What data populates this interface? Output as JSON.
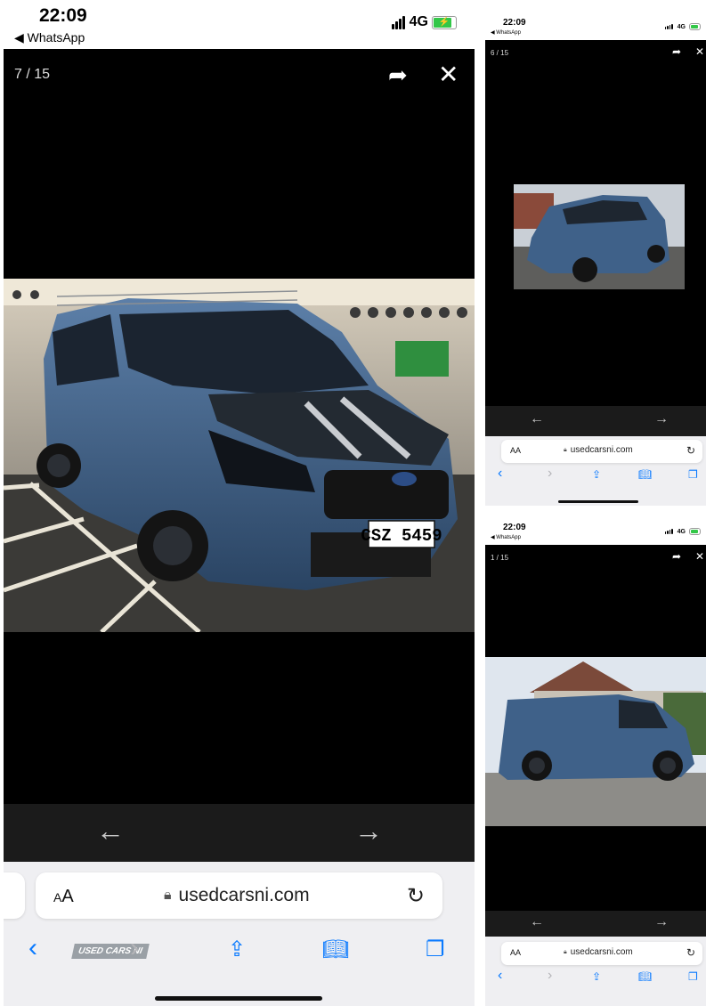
{
  "status": {
    "time": "22:09",
    "back_app": "WhatsApp",
    "network": "4G"
  },
  "main": {
    "counter": "7 / 15",
    "plate": "CSZ 5459",
    "url_domain": "usedcarsni.com",
    "aa_label": "AA",
    "watermark": "USED CARS NI"
  },
  "thumb_top": {
    "counter": "6 / 15",
    "url_domain": "usedcarsni.com",
    "aa_label": "AA"
  },
  "thumb_bottom": {
    "counter": "1 / 15",
    "url_domain": "usedcarsni.com",
    "aa_label": "AA"
  },
  "icons": {
    "share": "share-arrow-icon",
    "close": "close-icon",
    "prev": "arrow-left-icon",
    "next": "arrow-right-icon",
    "lock": "lock-icon",
    "reload": "reload-icon",
    "back": "chevron-left-icon",
    "forward": "chevron-right-icon",
    "share_sheet": "share-sheet-icon",
    "bookmarks": "book-icon",
    "tabs": "tabs-icon"
  },
  "colors": {
    "accent": "#0a7aff",
    "battery": "#33c748",
    "viewer_bg": "#000000",
    "van": "#3a5a80"
  }
}
